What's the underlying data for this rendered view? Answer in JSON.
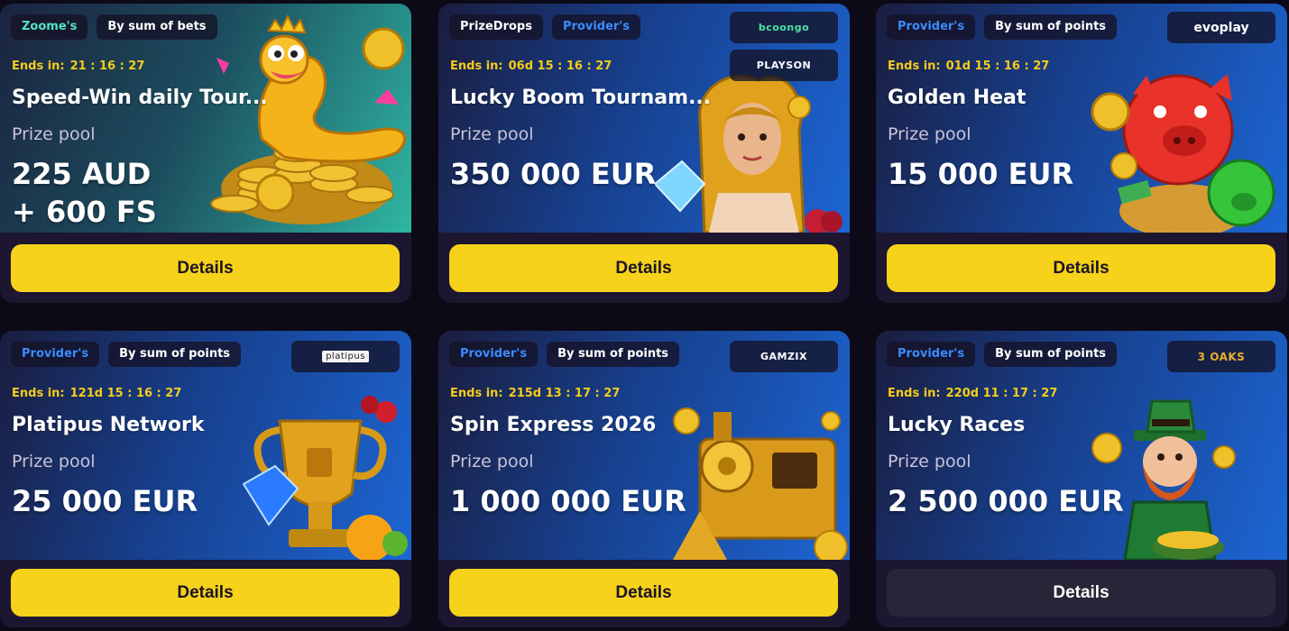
{
  "cards": [
    {
      "tags": [
        "Zoome's",
        "By sum of bets"
      ],
      "logos": [],
      "ends_label": "Ends in:",
      "ends_value": "21 : 16 : 27",
      "title": "Speed-Win daily Tour...",
      "prize_label": "Prize pool",
      "prize_line1": "225 AUD",
      "prize_line2": "+ 600 FS",
      "button": "Details"
    },
    {
      "tags": [
        "PrizeDrops",
        "Provider's"
      ],
      "logos": [
        "bcoongo",
        "PLAYSON"
      ],
      "ends_label": "Ends in:",
      "ends_value": "06d 15 : 16 : 27",
      "title": "Lucky Boom Tournam...",
      "prize_label": "Prize pool",
      "prize_line1": "350 000 EUR",
      "button": "Details"
    },
    {
      "tags": [
        "Provider's",
        "By sum of points"
      ],
      "logos": [
        "evoplay"
      ],
      "ends_label": "Ends in:",
      "ends_value": "01d 15 : 16 : 27",
      "title": "Golden Heat",
      "prize_label": "Prize pool",
      "prize_line1": "15 000 EUR",
      "button": "Details"
    },
    {
      "tags": [
        "Provider's",
        "By sum of points"
      ],
      "logos": [
        "platipus"
      ],
      "ends_label": "Ends in:",
      "ends_value": "121d 15 : 16 : 27",
      "title": "Platipus Network",
      "prize_label": "Prize pool",
      "prize_line1": "25 000 EUR",
      "button": "Details"
    },
    {
      "tags": [
        "Provider's",
        "By sum of points"
      ],
      "logos": [
        "GAMZIX"
      ],
      "ends_label": "Ends in:",
      "ends_value": "215d 13 : 17 : 27",
      "title": "Spin Express 2026",
      "prize_label": "Prize pool",
      "prize_line1": "1 000 000 EUR",
      "button": "Details"
    },
    {
      "tags": [
        "Provider's",
        "By sum of points"
      ],
      "logos": [
        "3 OAKS"
      ],
      "ends_label": "Ends in:",
      "ends_value": "220d 11 : 17 : 27",
      "title": "Lucky Races",
      "prize_label": "Prize pool",
      "prize_line1": "2 500 000 EUR",
      "button": "Details"
    }
  ],
  "colors": {
    "accent_yellow": "#f6d21a",
    "countdown_yellow": "#f5cc1c",
    "tag_green": "#53e3c6",
    "tag_blue": "#3a8cff",
    "page_bg": "#0d0a17",
    "card_bg": "#1c1631"
  }
}
